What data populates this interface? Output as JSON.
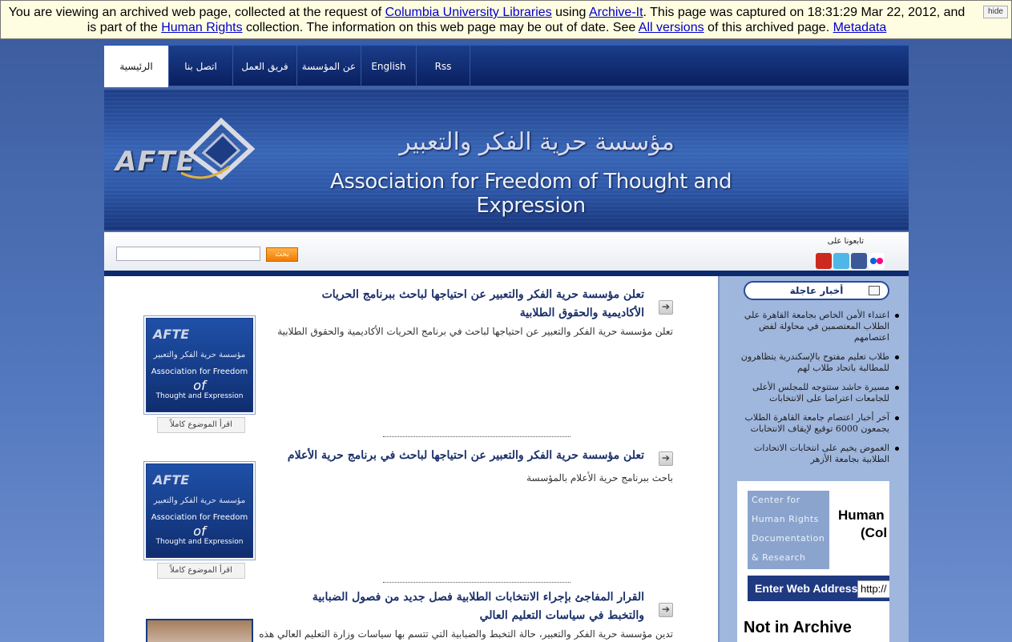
{
  "banner": {
    "t1": "You are viewing an archived web page, collected at the request of ",
    "link_columbia": "Columbia University Libraries",
    "t2": " using ",
    "link_archiveit": "Archive-It",
    "t3": ". This page was captured on 18:31:29 Mar 22, 2012, and is part of the ",
    "link_collection": "Human Rights",
    "t4": " collection. The information on this web page may be out of date. See ",
    "link_versions": "All versions",
    "t5": " of this archived page. ",
    "link_metadata": "Metadata",
    "hide": "hide"
  },
  "nav": {
    "tabs": [
      "الرئيسية",
      "اتصل بنا",
      "فريق العمل",
      "عن المؤسسة",
      "English",
      "Rss"
    ]
  },
  "header": {
    "logo_text": "AFTE",
    "title_ar": "مؤسسة حرية الفكر والتعبير",
    "title_en": "Association for Freedom of Thought and Expression"
  },
  "search": {
    "button": "بحث",
    "placeholder": "",
    "follow_label": "تابعونا على",
    "social_icons": [
      "youtube-icon",
      "twitter-icon",
      "facebook-icon",
      "flickr-icon"
    ]
  },
  "articles": [
    {
      "title": "تعلن مؤسسة حرية الفكر والتعبير عن احتياجها لباحث ببرنامج الحريات الأكاديمية والحقوق الطلابية",
      "body": "تعلن مؤسسة حرية الفكر والتعبير عن احتياجها لباحث في برنامج الحريات الأكاديمية والحقوق الطلابية",
      "readmore": "اقرأ الموضوع كاملاً"
    },
    {
      "title": "تعلن مؤسسة حرية الفكر والتعبير عن احتياجها لباحث في برنامج حرية الأعلام",
      "body": "باحث ببرنامج حرية الأعلام بالمؤسسة",
      "readmore": "اقرأ الموضوع كاملاً"
    },
    {
      "title": "القرار المفاجئ بإجراء الانتخابات الطلابية فصل جديد من فصول الضبابية والتخبط في سياسات التعليم العالي",
      "body": "تدين مؤسسة حرية الفكر والتعبير، حالة التخبط والضبابية التي تتسم بها سياسات وزارة التعليم العالي هذه"
    }
  ],
  "thumb": {
    "logo": "AFTE",
    "ar": "مؤسسة حرية الفكر والتعبير",
    "en1": "Association for Freedom",
    "en2": "of",
    "en3": "Thought and Expression"
  },
  "sidebar": {
    "news_title": "أخبار عاجلة",
    "news": [
      "اعتداء الأمن الخاص بجامعة القاهرة علي الطلاب المعتصمين في محاولة لفض اعتصامهم",
      "طلاب تعليم مفتوح بالإسكندرية يتظاهرون للمطالبة باتحاد طلاب لهم",
      "مسيرة حاشد ستتوجه للمجلس الأعلى للجامعات اعتراضا على الانتخابات",
      "آخر أخبار اعتصام جامعة القاهرة الطلاب يجمعون 6000 توقيع لإيقاف الانتخابات",
      "الغموض يخيم على انتخابات الاتحادات الطلابية بجامعة الأزهر"
    ],
    "widget": {
      "chr_lines": [
        "Center for",
        "Human Rights",
        "Documentation",
        "& Research"
      ],
      "hr_title_1": "Human",
      "hr_title_2": "(Col",
      "enter_label": "Enter Web Address:",
      "url_value": "http://",
      "not_in_archive": "Not in Archive"
    }
  },
  "colors": {
    "nav_bg": "#0a2060",
    "accent_orange": "#f07c00",
    "link_blue": "#0000cc"
  }
}
